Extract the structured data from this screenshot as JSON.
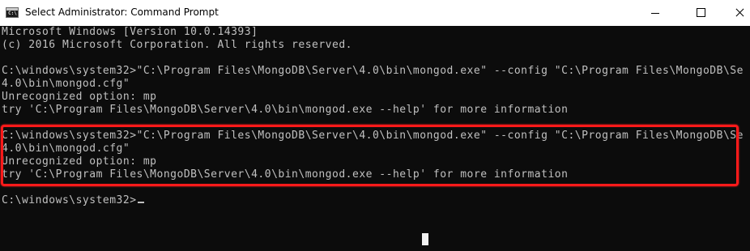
{
  "window": {
    "title": "Select Administrator: Command Prompt",
    "app_icon": "cmd-icon",
    "app_icon_text": "C:\\",
    "controls": [
      "minimize-icon",
      "maximize-icon",
      "close-icon"
    ]
  },
  "console": {
    "block1": "Microsoft Windows [Version 10.0.14393]\n(c) 2016 Microsoft Corporation. All rights reserved.",
    "block2": "C:\\windows\\system32>\"C:\\Program Files\\MongoDB\\Server\\4.0\\bin\\mongod.exe\" --config \"C:\\Program Files\\MongoDB\\Server\\\n4.0\\bin\\mongod.cfg\"\nUnrecognized option: mp\ntry 'C:\\Program Files\\MongoDB\\Server\\4.0\\bin\\mongod.exe --help' for more information",
    "block3": "C:\\windows\\system32>\"C:\\Program Files\\MongoDB\\Server\\4.0\\bin\\mongod.exe\" --config \"C:\\Program Files\\MongoDB\\Server\\\n4.0\\bin\\mongod.cfg\"\nUnrecognized option: mp\ntry 'C:\\Program Files\\MongoDB\\Server\\4.0\\bin\\mongod.exe --help' for more information",
    "prompt": "C:\\windows\\system32>"
  },
  "colors": {
    "console_bg": "#0c0c0c",
    "console_text": "#c0c0c0",
    "highlight": "#ff1a1a"
  }
}
